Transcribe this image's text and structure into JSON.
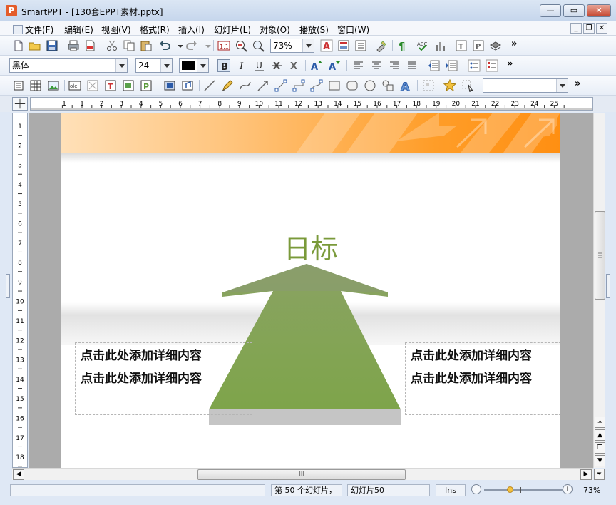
{
  "window": {
    "title": "SmartPPT - [130套EPPT素材.pptx]",
    "app_icon_letter": "P",
    "buttons": {
      "minimize": "—",
      "restore": "▭",
      "close": "✕"
    }
  },
  "menu": {
    "items": [
      "文件(F)",
      "编辑(E)",
      "视图(V)",
      "格式(R)",
      "插入(I)",
      "幻灯片(L)",
      "对象(O)",
      "播放(S)",
      "窗口(W)"
    ],
    "mdi": {
      "minimize": "_",
      "restore": "❐",
      "close": "✕"
    }
  },
  "toolbar1": {
    "zoom_value": "73%",
    "overflow": "»"
  },
  "toolbar2": {
    "font_name": "黑体",
    "font_size": "24",
    "font_color": "#000000",
    "overflow": "»"
  },
  "toolbar3": {
    "overflow": "»",
    "object_select_value": ""
  },
  "ruler": {
    "h_ticks": [
      "1",
      "1",
      "2",
      "3",
      "4",
      "5",
      "6",
      "7",
      "8",
      "9",
      "10",
      "11",
      "12",
      "13",
      "14",
      "15",
      "16",
      "17",
      "18",
      "19",
      "20",
      "21",
      "22",
      "23",
      "24",
      "25"
    ],
    "v_ticks": [
      "1",
      "2",
      "3",
      "4",
      "5",
      "6",
      "7",
      "8",
      "9",
      "10",
      "11",
      "12",
      "13",
      "14",
      "15",
      "16",
      "17",
      "18"
    ]
  },
  "slide": {
    "title": "日标",
    "left_box": {
      "lines": [
        "点击此处添加详细内容",
        "点击此处添加详细内容"
      ]
    },
    "right_box": {
      "lines": [
        "点击此处添加详细内容",
        "点击此处添加详细内容"
      ]
    },
    "colors": {
      "title": "#7a9a3a",
      "arrow_top": "#8aa363",
      "arrow_bottom": "#7ea44a",
      "banner": "#ff9d28"
    }
  },
  "scroll": {
    "h_thumb_grip": "III"
  },
  "status": {
    "slide_number": "第 50 个幻灯片，",
    "slide_name": "幻灯片50",
    "mode": "Ins",
    "zoom": "73%"
  }
}
